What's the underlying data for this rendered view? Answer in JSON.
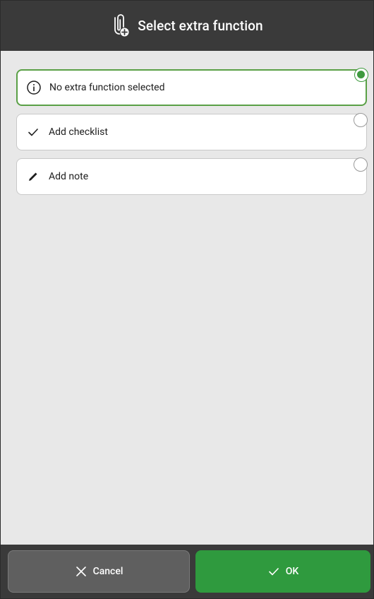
{
  "dialog": {
    "title": "Select extra function",
    "title_icon": "paperclip-add-icon"
  },
  "options": [
    {
      "label": "No extra function selected",
      "icon": "info-icon",
      "selected": true
    },
    {
      "label": "Add checklist",
      "icon": "checkmark-icon",
      "selected": false
    },
    {
      "label": "Add note",
      "icon": "pencil-icon",
      "selected": false
    }
  ],
  "footer": {
    "cancel_label": "Cancel",
    "cancel_icon": "close-icon",
    "ok_label": "OK",
    "ok_icon": "checkmark-icon"
  },
  "colors": {
    "header_bg": "#3a3a3a",
    "content_bg": "#e8e8e8",
    "accent_green": "#2f9a3e",
    "selected_border": "#5aa046",
    "cancel_bg": "#5f5f5f"
  }
}
